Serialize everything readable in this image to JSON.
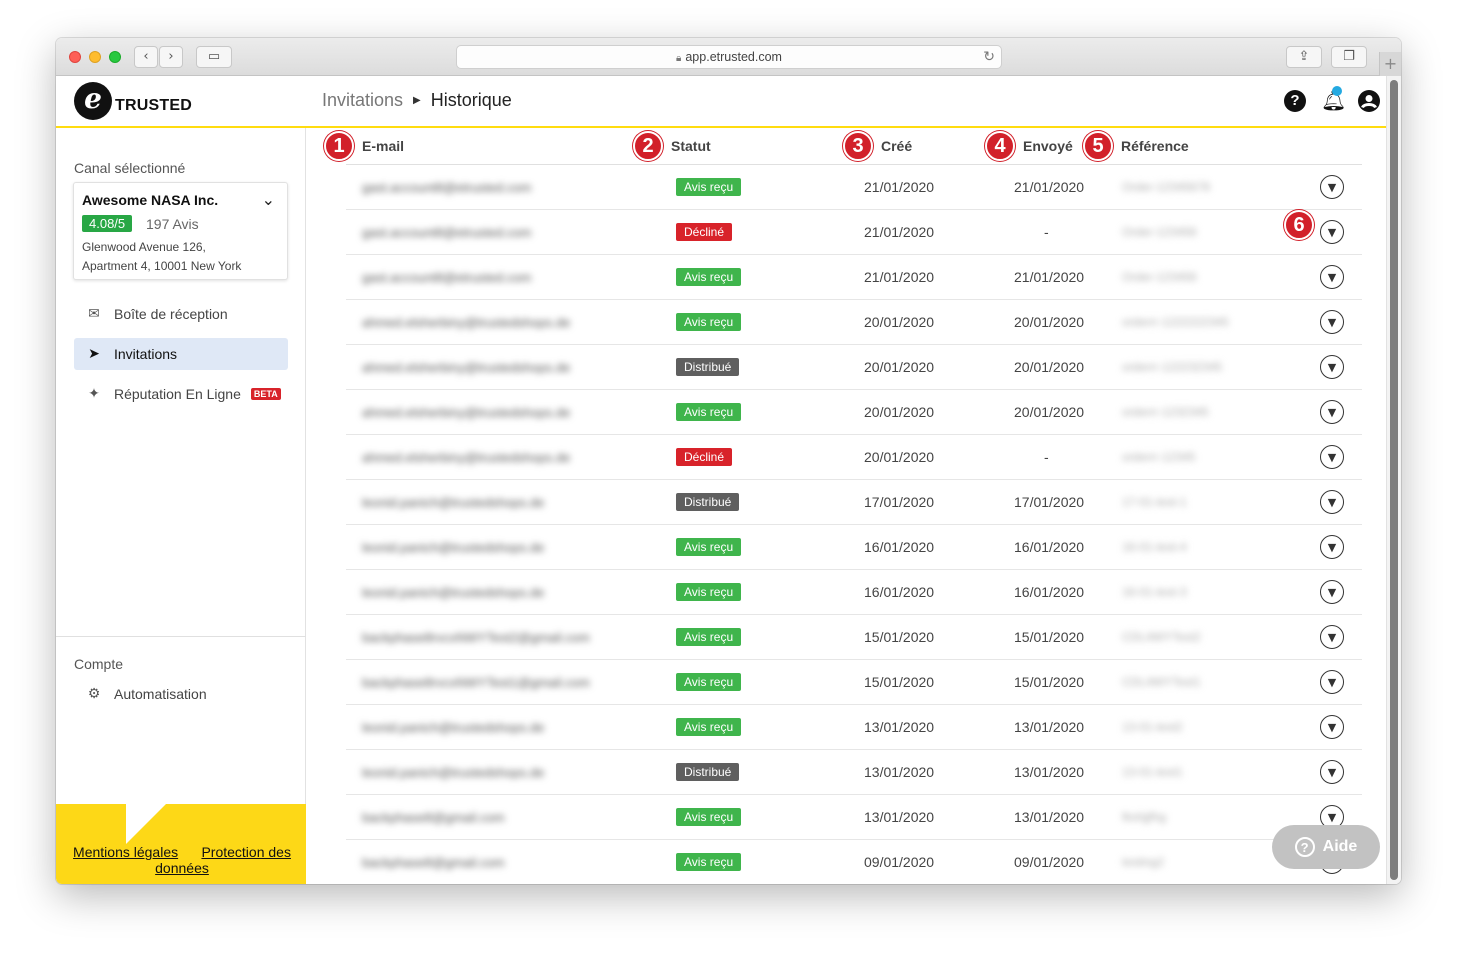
{
  "browser": {
    "url": "app.etrusted.com"
  },
  "header": {
    "logo_text": "TRUSTED",
    "logo_glyph": "e",
    "breadcrumb_parent": "Invitations",
    "breadcrumb_current": "Historique",
    "help_icon_glyph": "?"
  },
  "sidebar": {
    "channel_title": "Canal sélectionné",
    "channel": {
      "name": "Awesome NASA Inc.",
      "rating": "4.08/5",
      "review_count": "197 Avis",
      "address_line1": "Glenwood Avenue 126,",
      "address_line2": "Apartment 4, 10001 New York"
    },
    "items": [
      {
        "label": "Boîte de réception",
        "icon": "inbox-icon"
      },
      {
        "label": "Invitations",
        "icon": "paper-plane-icon"
      },
      {
        "label": "Réputation En Ligne",
        "icon": "sparkles-icon",
        "badge": "BETA"
      }
    ],
    "account_title": "Compte",
    "account_items": [
      {
        "label": "Automatisation",
        "icon": "robot-icon"
      }
    ]
  },
  "footer": {
    "legal_link": "Mentions légales",
    "privacy_link_part1": "Protection des",
    "privacy_link_part2": "données"
  },
  "table": {
    "columns": [
      {
        "label": "E-mail",
        "badge": "1"
      },
      {
        "label": "Statut",
        "badge": "2"
      },
      {
        "label": "Créé",
        "badge": "3"
      },
      {
        "label": "Envoyé",
        "badge": "4"
      },
      {
        "label": "Référence",
        "badge": "5"
      }
    ],
    "expand_badge": "6",
    "rows": [
      {
        "email": "gast.account8@etrusted.com",
        "status": "Avis reçu",
        "status_type": "ok",
        "created": "21/01/2020",
        "sent": "21/01/2020",
        "reference": "Order-12345678"
      },
      {
        "email": "gast.account8@etrusted.com",
        "status": "Décliné",
        "status_type": "declined",
        "created": "21/01/2020",
        "sent": "-",
        "reference": "Order-123456"
      },
      {
        "email": "gast.account8@etrusted.com",
        "status": "Avis reçu",
        "status_type": "ok",
        "created": "21/01/2020",
        "sent": "21/01/2020",
        "reference": "Order-123456"
      },
      {
        "email": "ahmed.elsherbiny@trustedshops.de",
        "status": "Avis reçu",
        "status_type": "ok",
        "created": "20/01/2020",
        "sent": "20/01/2020",
        "reference": "orderrr-1222222345"
      },
      {
        "email": "ahmed.elsherbiny@trustedshops.de",
        "status": "Distribué",
        "status_type": "distributed",
        "created": "20/01/2020",
        "sent": "20/01/2020",
        "reference": "orderrr-122232345"
      },
      {
        "email": "ahmed.elsherbiny@trustedshops.de",
        "status": "Avis reçu",
        "status_type": "ok",
        "created": "20/01/2020",
        "sent": "20/01/2020",
        "reference": "orderrr-1232345"
      },
      {
        "email": "ahmed.elsherbiny@trustedshops.de",
        "status": "Décliné",
        "status_type": "declined",
        "created": "20/01/2020",
        "sent": "-",
        "reference": "orderrr-12345"
      },
      {
        "email": "leonid.panich@trustedshops.de",
        "status": "Distribué",
        "status_type": "distributed",
        "created": "17/01/2020",
        "sent": "17/01/2020",
        "reference": "17-01-test-1"
      },
      {
        "email": "leonid.panich@trustedshops.de",
        "status": "Avis reçu",
        "status_type": "ok",
        "created": "16/01/2020",
        "sent": "16/01/2020",
        "reference": "16-01-test-4"
      },
      {
        "email": "leonid.panich@trustedshops.de",
        "status": "Avis reçu",
        "status_type": "ok",
        "created": "16/01/2020",
        "sent": "16/01/2020",
        "reference": "16-01-test-3"
      },
      {
        "email": "backphase8rvcxNWYTest2@gmail.com",
        "status": "Avis reçu",
        "status_type": "ok",
        "created": "15/01/2020",
        "sent": "15/01/2020",
        "reference": "CDL4WYTest2"
      },
      {
        "email": "backphase8rvcxNWYTest1@gmail.com",
        "status": "Avis reçu",
        "status_type": "ok",
        "created": "15/01/2020",
        "sent": "15/01/2020",
        "reference": "CDL4WYTest1"
      },
      {
        "email": "leonid.panich@trustedshops.de",
        "status": "Avis reçu",
        "status_type": "ok",
        "created": "13/01/2020",
        "sent": "13/01/2020",
        "reference": "13-01-test2"
      },
      {
        "email": "leonid.panich@trustedshops.de",
        "status": "Distribué",
        "status_type": "distributed",
        "created": "13/01/2020",
        "sent": "13/01/2020",
        "reference": "13-01-test1"
      },
      {
        "email": "backphase8@gmail.com",
        "status": "Avis reçu",
        "status_type": "ok",
        "created": "13/01/2020",
        "sent": "13/01/2020",
        "reference": "fkshjjfhg"
      },
      {
        "email": "backphase8@gmail.com",
        "status": "Avis reçu",
        "status_type": "ok",
        "created": "09/01/2020",
        "sent": "09/01/2020",
        "reference": "testing2"
      }
    ]
  },
  "help_button": {
    "label": "Aide",
    "glyph": "?"
  },
  "colors": {
    "accent_yellow": "#ffdc0f",
    "status_ok": "#3fb54c",
    "status_declined": "#d8232a",
    "status_distributed": "#5f5f5f",
    "badge_red": "#d2202a",
    "rating_green": "#28a745"
  }
}
